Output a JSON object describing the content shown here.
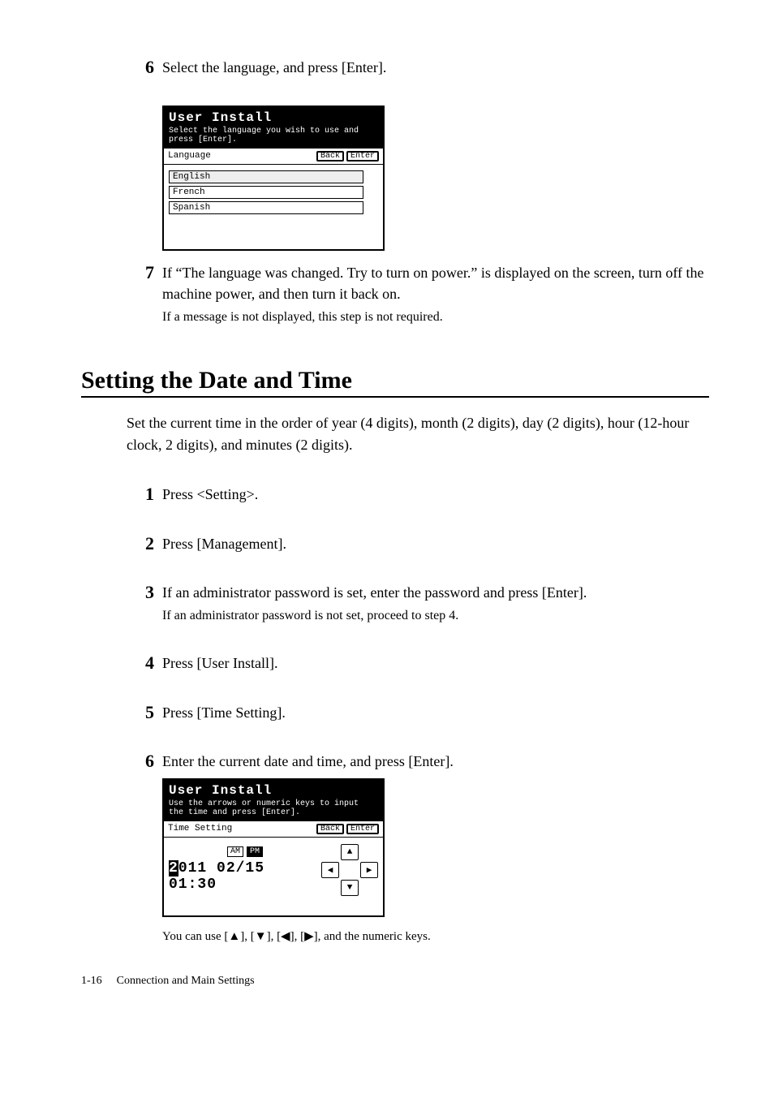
{
  "step6a": {
    "num": "6",
    "text": "Select the language, and press [Enter]."
  },
  "lcd1": {
    "title": "User Install",
    "sub": "Select the language you wish to use and press [Enter].",
    "label": "Language",
    "back": "Back",
    "enter": "Enter",
    "items": [
      "English",
      "French",
      "Spanish"
    ]
  },
  "step7": {
    "num": "7",
    "text": "If “The language was changed. Try to turn on power.” is displayed on the screen, turn off the machine power, and then turn it back on.",
    "note": "If a message is not displayed, this step is not required."
  },
  "section": "Setting the Date and Time",
  "intro": "Set the current time in the order of year (4 digits), month (2 digits), day (2 digits), hour (12-hour clock, 2 digits), and minutes (2 digits).",
  "s1": {
    "num": "1",
    "text": "Press <Setting>."
  },
  "s2": {
    "num": "2",
    "text": "Press [Management]."
  },
  "s3": {
    "num": "3",
    "text": "If an administrator password is set, enter the password and press [Enter].",
    "note": "If an administrator password is not set, proceed to step 4."
  },
  "s4": {
    "num": "4",
    "text": "Press [User Install]."
  },
  "s5": {
    "num": "5",
    "text": "Press [Time Setting]."
  },
  "s6": {
    "num": "6",
    "text": "Enter the current date and time, and press [Enter]."
  },
  "lcd2": {
    "title": "User Install",
    "sub": "Use the arrows or numeric keys to input the time and press [Enter].",
    "label": "Time Setting",
    "back": "Back",
    "enter": "Enter",
    "am": "AM",
    "pm": "PM",
    "time_cursor": "2",
    "time_rest": "011 02/15 01:30",
    "up": "▲",
    "down": "▼",
    "left": "◀",
    "right": "▶"
  },
  "footnote": "You can use [▲], [▼], [◀], [▶], and the numeric keys.",
  "footer_page": "1-16",
  "footer_title": "Connection and Main Settings"
}
